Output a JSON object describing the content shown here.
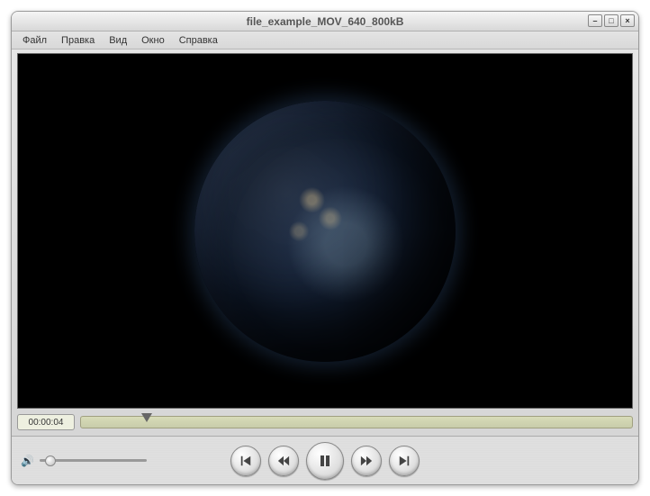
{
  "window": {
    "title": "file_example_MOV_640_800kB"
  },
  "menu": {
    "items": [
      "Файл",
      "Правка",
      "Вид",
      "Окно",
      "Справка"
    ]
  },
  "playback": {
    "current_time": "00:00:04",
    "progress_percent": 12,
    "volume_percent": 10
  },
  "controls": {
    "minimize": "–",
    "maximize": "□",
    "close": "×"
  }
}
